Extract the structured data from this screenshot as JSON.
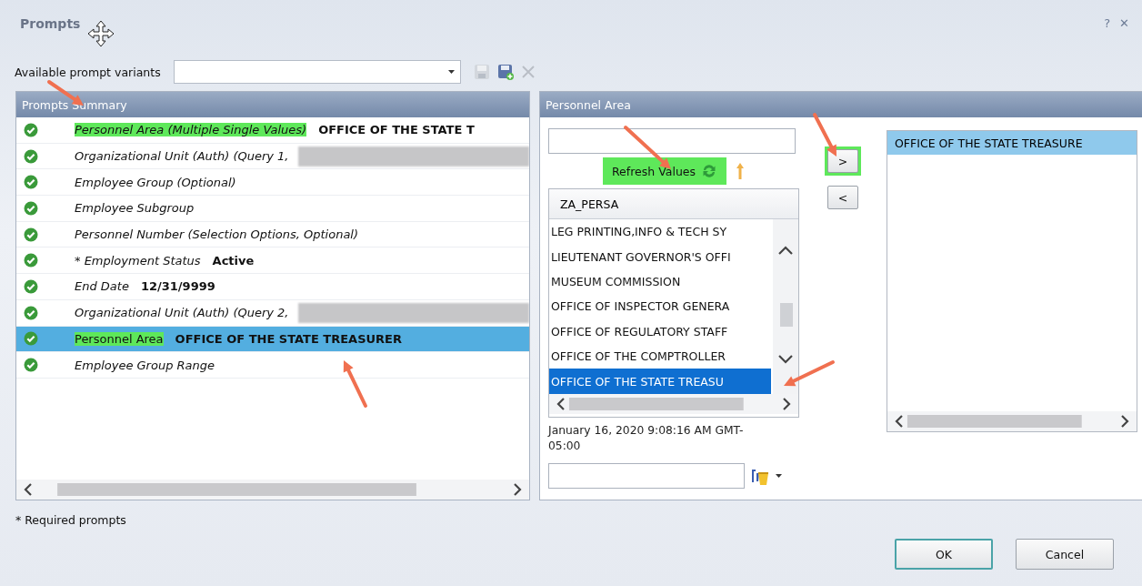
{
  "window": {
    "title": "Prompts",
    "controls": [
      "?",
      "✕"
    ]
  },
  "variants": {
    "label": "Available prompt variants"
  },
  "summary": {
    "title": "Prompts Summary",
    "rows": [
      {
        "label": "Personnel Area (Multiple Single Values)",
        "value": "OFFICE OF THE STATE T",
        "selected": false,
        "marker": true,
        "redacted": false
      },
      {
        "label": "Organizational Unit (Auth) (Query 1,",
        "selected": false,
        "marker": false,
        "redacted": true
      },
      {
        "label": "Employee Group (Optional)",
        "selected": false,
        "marker": false,
        "redacted": false
      },
      {
        "label": "Employee Subgroup",
        "selected": false,
        "marker": false,
        "redacted": false
      },
      {
        "label": "Personnel Number (Selection Options, Optional)",
        "selected": false,
        "marker": false,
        "redacted": false
      },
      {
        "label": "* Employment Status",
        "value": "Active",
        "selected": false,
        "marker": false,
        "redacted": false
      },
      {
        "label": "End Date",
        "value": "12/31/9999",
        "selected": false,
        "marker": false,
        "redacted": false
      },
      {
        "label": "Organizational Unit (Auth) (Query 2,",
        "selected": false,
        "marker": false,
        "redacted": true
      },
      {
        "label": "Personnel Area",
        "value": "OFFICE OF THE STATE TREASURER",
        "selected": true,
        "marker": true,
        "redacted": false
      },
      {
        "label": "Employee Group Range",
        "selected": false,
        "marker": false,
        "redacted": false
      }
    ]
  },
  "selector": {
    "title": "Personnel Area",
    "refresh": {
      "label": "Refresh Values",
      "marker": true
    },
    "add": {
      "label": ">",
      "marker": true
    },
    "remove": {
      "label": "<",
      "marker": false
    },
    "list": {
      "column": "ZA_PERSA",
      "items": [
        {
          "text": "LEG PRINTING,INFO & TECH SY",
          "selected": false
        },
        {
          "text": "LIEUTENANT GOVERNOR'S OFFI",
          "selected": false
        },
        {
          "text": "MUSEUM COMMISSION",
          "selected": false
        },
        {
          "text": "OFFICE OF INSPECTOR GENERA",
          "selected": false
        },
        {
          "text": "OFFICE OF REGULATORY STAFF",
          "selected": false
        },
        {
          "text": "OFFICE OF THE COMPTROLLER",
          "selected": false
        },
        {
          "text": "OFFICE OF THE STATE TREASU",
          "selected": true
        }
      ]
    },
    "chosen": [
      {
        "text": "OFFICE OF THE STATE TREASURE",
        "selected": true
      }
    ],
    "key_date": "January 16, 2020 9:08:16 AM GMT-05:00"
  },
  "footer": {
    "note": "* Required prompts",
    "buttons": [
      {
        "label": "OK",
        "default": true
      },
      {
        "label": "Cancel",
        "default": false
      }
    ]
  }
}
